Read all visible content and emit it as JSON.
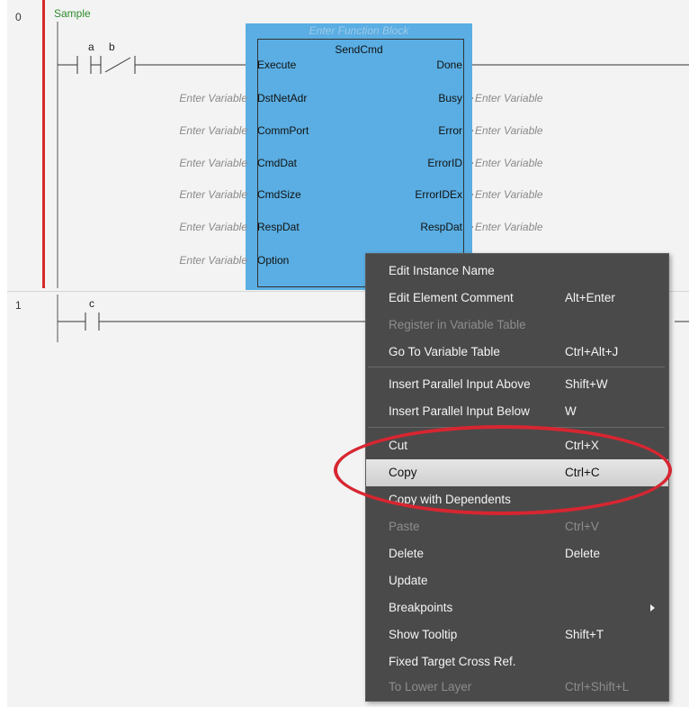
{
  "rungs": [
    {
      "number": "0",
      "comment": "Sample"
    },
    {
      "number": "1",
      "comment": ""
    }
  ],
  "contacts": {
    "a": "a",
    "b": "b",
    "c": "c"
  },
  "function_block": {
    "hint": "Enter Function Block",
    "name": "SendCmd",
    "inputs": [
      "Execute",
      "DstNetAdr",
      "CommPort",
      "CmdDat",
      "CmdSize",
      "RespDat",
      "Option"
    ],
    "outputs": [
      "Done",
      "Busy",
      "Error",
      "ErrorID",
      "ErrorIDEx",
      "RespDat"
    ],
    "placeholder": "Enter Variable"
  },
  "context_menu": {
    "items": [
      {
        "label": "Edit Instance Name",
        "shortcut": "",
        "enabled": true
      },
      {
        "label": "Edit Element Comment",
        "shortcut": "Alt+Enter",
        "enabled": true
      },
      {
        "label": "Register in Variable Table",
        "shortcut": "",
        "enabled": false
      },
      {
        "label": "Go To Variable Table",
        "shortcut": "Ctrl+Alt+J",
        "enabled": true
      },
      {
        "label": "Insert Parallel Input Above",
        "shortcut": "Shift+W",
        "enabled": true
      },
      {
        "label": "Insert Parallel Input Below",
        "shortcut": "W",
        "enabled": true
      },
      {
        "label": "Cut",
        "shortcut": "Ctrl+X",
        "enabled": true
      },
      {
        "label": "Copy",
        "shortcut": "Ctrl+C",
        "enabled": true,
        "highlighted": true
      },
      {
        "label": "Copy with Dependents",
        "shortcut": "",
        "enabled": true
      },
      {
        "label": "Paste",
        "shortcut": "Ctrl+V",
        "enabled": false
      },
      {
        "label": "Delete",
        "shortcut": "Delete",
        "enabled": true
      },
      {
        "label": "Update",
        "shortcut": "",
        "enabled": true
      },
      {
        "label": "Breakpoints",
        "shortcut": "",
        "enabled": true,
        "submenu": true
      },
      {
        "label": "Show Tooltip",
        "shortcut": "Shift+T",
        "enabled": true
      },
      {
        "label": "Fixed Target Cross Ref.",
        "shortcut": "",
        "enabled": true
      },
      {
        "label": "To Lower Layer",
        "shortcut": "Ctrl+Shift+L",
        "enabled": false
      }
    ]
  },
  "colors": {
    "highlight_ellipse": "#d72631",
    "function_block": "#5aaee3",
    "rail": "#d42a2a"
  }
}
